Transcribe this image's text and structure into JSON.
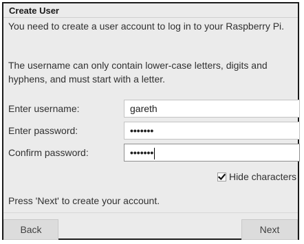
{
  "dialog": {
    "title": "Create User"
  },
  "intro": {
    "line1": "You need to create a user account to log in to your Raspberry Pi.",
    "line2": "The username can only contain lower-case letters, digits and hyphens, and must start with a letter."
  },
  "form": {
    "username_label": "Enter username:",
    "username_value": "gareth",
    "password_label": "Enter password:",
    "password_value": "•••••••",
    "confirm_label": "Confirm password:",
    "confirm_value": "•••••••",
    "hide_characters_label": "Hide characters",
    "hide_characters_checked": true
  },
  "footer": {
    "hint": "Press 'Next' to create your account.",
    "back_label": "Back",
    "next_label": "Next"
  }
}
